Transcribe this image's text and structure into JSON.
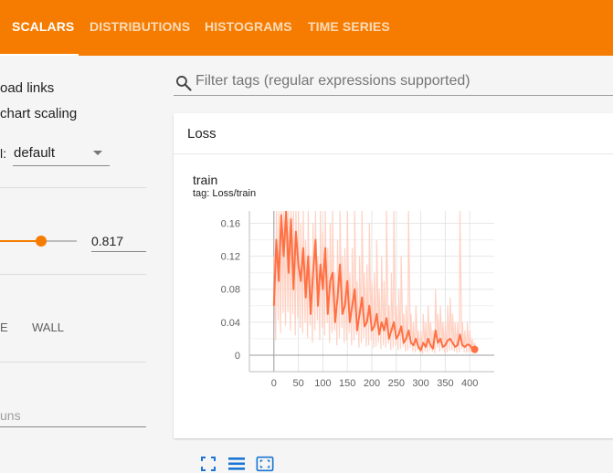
{
  "colors": {
    "brand": "#f57c00",
    "series": "#ff7043",
    "series_light": "#ffccbc"
  },
  "nav": {
    "tabs": [
      {
        "label": "SCALARS",
        "active": true
      },
      {
        "label": "DISTRIBUTIONS",
        "active": false
      },
      {
        "label": "HISTOGRAMS",
        "active": false
      },
      {
        "label": "TIME SERIES",
        "active": false
      }
    ]
  },
  "sidebar": {
    "download_links": "oad links",
    "chart_scaling": "chart scaling",
    "tooltip_sort_label": "l:",
    "tooltip_sort_value": "default",
    "smoothing_value": "0.817",
    "smoothing_level": 0.53,
    "axis_option_partial": "E",
    "axis_option_wall": "WALL",
    "runs_filter_placeholder": "uns"
  },
  "main": {
    "search_placeholder": "Filter tags (regular expressions supported)",
    "group_title": "Loss",
    "card_title": "train",
    "card_tag": "tag: Loss/train"
  },
  "chart_data": {
    "type": "line",
    "title": "train",
    "xlabel": "",
    "ylabel": "",
    "xlim": [
      -50,
      450
    ],
    "ylim": [
      -0.02,
      0.175
    ],
    "x_ticks": [
      "0",
      "50",
      "100",
      "150",
      "200",
      "250",
      "300",
      "350",
      "400"
    ],
    "y_ticks": [
      "0.16",
      "0.12",
      "0.08",
      "0.04",
      "0"
    ],
    "grid": true,
    "series": [
      {
        "name": "train",
        "x": [
          0,
          5,
          10,
          15,
          20,
          25,
          30,
          35,
          40,
          45,
          50,
          55,
          60,
          65,
          70,
          75,
          80,
          85,
          90,
          95,
          100,
          105,
          110,
          115,
          120,
          125,
          130,
          135,
          140,
          145,
          150,
          155,
          160,
          165,
          170,
          175,
          180,
          185,
          190,
          195,
          200,
          205,
          210,
          215,
          220,
          225,
          230,
          235,
          240,
          245,
          250,
          255,
          260,
          265,
          270,
          275,
          280,
          285,
          290,
          295,
          300,
          305,
          310,
          315,
          320,
          325,
          330,
          335,
          340,
          345,
          350,
          355,
          360,
          365,
          370,
          375,
          380,
          385,
          390,
          395,
          400,
          405,
          410
        ],
        "smoothed": [
          0.06,
          0.14,
          0.09,
          0.17,
          0.12,
          0.175,
          0.1,
          0.165,
          0.08,
          0.15,
          0.11,
          0.09,
          0.13,
          0.07,
          0.12,
          0.05,
          0.1,
          0.14,
          0.06,
          0.11,
          0.08,
          0.13,
          0.05,
          0.09,
          0.1,
          0.04,
          0.07,
          0.11,
          0.05,
          0.06,
          0.09,
          0.04,
          0.06,
          0.08,
          0.03,
          0.05,
          0.07,
          0.035,
          0.04,
          0.06,
          0.03,
          0.035,
          0.05,
          0.025,
          0.04,
          0.03,
          0.045,
          0.02,
          0.03,
          0.04,
          0.02,
          0.025,
          0.035,
          0.015,
          0.02,
          0.03,
          0.015,
          0.012,
          0.02,
          0.01,
          0.006,
          0.015,
          0.01,
          0.02,
          0.012,
          0.008,
          0.03,
          0.015,
          0.02,
          0.01,
          0.012,
          0.018,
          0.02,
          0.015,
          0.01,
          0.012,
          0.025,
          0.012,
          0.01,
          0.013,
          0.012,
          0.008,
          0.007
        ],
        "raw_max": [
          0.12,
          0.175,
          0.175,
          0.175,
          0.175,
          0.175,
          0.175,
          0.175,
          0.175,
          0.175,
          0.175,
          0.16,
          0.175,
          0.14,
          0.175,
          0.12,
          0.16,
          0.175,
          0.12,
          0.175,
          0.15,
          0.175,
          0.13,
          0.16,
          0.175,
          0.1,
          0.14,
          0.175,
          0.12,
          0.13,
          0.175,
          0.1,
          0.13,
          0.175,
          0.09,
          0.12,
          0.175,
          0.1,
          0.11,
          0.16,
          0.09,
          0.1,
          0.14,
          0.08,
          0.12,
          0.09,
          0.175,
          0.06,
          0.1,
          0.175,
          0.06,
          0.08,
          0.12,
          0.05,
          0.06,
          0.175,
          0.05,
          0.04,
          0.06,
          0.03,
          0.03,
          0.05,
          0.04,
          0.06,
          0.04,
          0.03,
          0.08,
          0.05,
          0.06,
          0.04,
          0.04,
          0.06,
          0.07,
          0.05,
          0.04,
          0.04,
          0.175,
          0.04,
          0.03,
          0.04,
          0.03,
          0.02,
          0.015
        ]
      }
    ]
  },
  "toolbar_icons": [
    "fullscreen-icon",
    "data-table-icon",
    "fit-domain-icon"
  ]
}
